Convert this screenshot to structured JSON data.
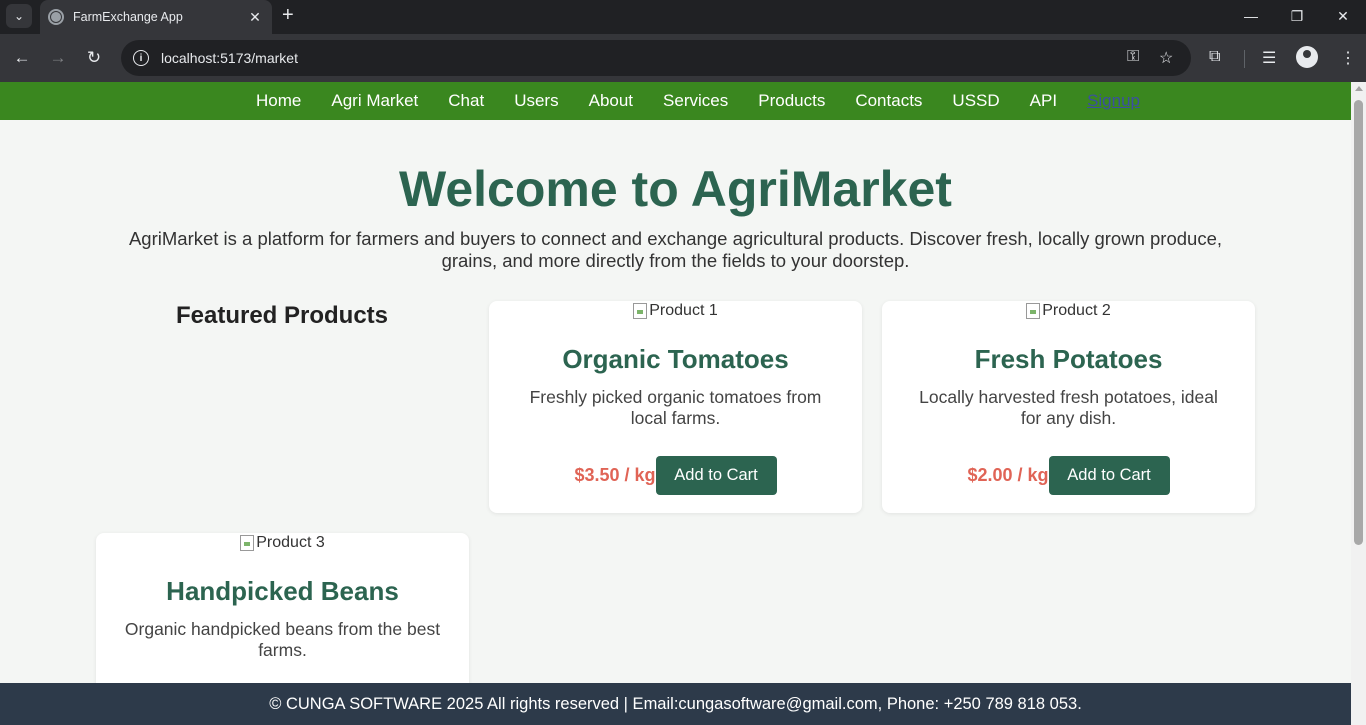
{
  "browser": {
    "tab_title": "FarmExchange App",
    "url": "localhost:5173/market",
    "icons": [
      "tab-list-icon",
      "close-tab-icon",
      "new-tab-icon",
      "minimize-icon",
      "restore-icon",
      "close-window-icon",
      "back-icon",
      "forward-icon",
      "reload-icon",
      "site-info-icon",
      "key-icon",
      "star-icon",
      "extensions-icon",
      "media-icon",
      "profile-icon",
      "menu-icon"
    ]
  },
  "nav": {
    "items": [
      "Home",
      "Agri Market",
      "Chat",
      "Users",
      "About",
      "Services",
      "Products",
      "Contacts",
      "USSD",
      "API"
    ],
    "signup": "Signup"
  },
  "hero": {
    "title": "Welcome to AgriMarket",
    "description": "AgriMarket is a platform for farmers and buyers to connect and exchange agricultural products. Discover fresh, locally grown produce, grains, and more directly from the fields to your doorstep."
  },
  "featured": {
    "title": "Featured Products",
    "products": [
      {
        "img_alt": "Product 1",
        "name": "Organic Tomatoes",
        "description": "Freshly picked organic tomatoes from local farms.",
        "price": "$3.50 / kg",
        "button": "Add to Cart"
      },
      {
        "img_alt": "Product 2",
        "name": "Fresh Potatoes",
        "description": "Locally harvested fresh potatoes, ideal for any dish.",
        "price": "$2.00 / kg",
        "button": "Add to Cart"
      },
      {
        "img_alt": "Product 3",
        "name": "Handpicked Beans",
        "description": "Organic handpicked beans from the best farms.",
        "price": "",
        "button": ""
      }
    ]
  },
  "footer": {
    "text": "© CUNGA SOFTWARE 2025 All rights reserved | Email:cungasoftware@gmail.com, Phone: +250 789 818 053."
  },
  "colors": {
    "nav_bg": "#3a871f",
    "brand_green": "#2c6450",
    "price_red": "#e06456",
    "footer_bg": "#2d3a4a"
  }
}
